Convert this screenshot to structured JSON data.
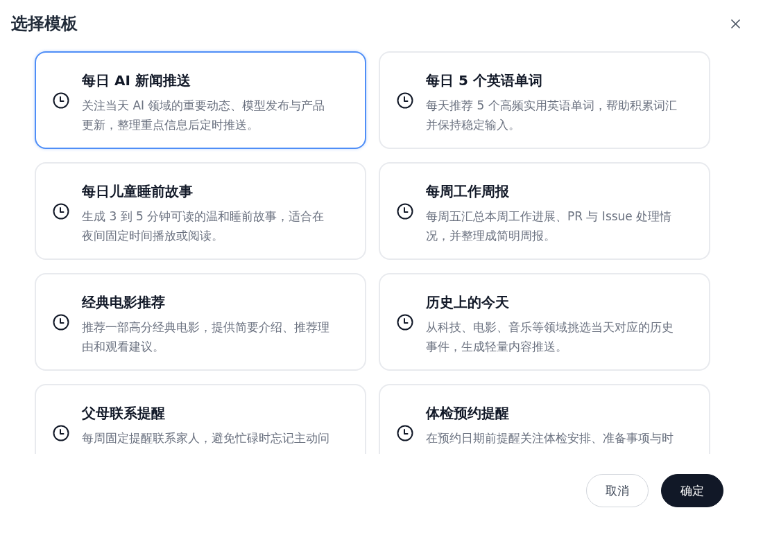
{
  "dialog": {
    "title": "选择模板"
  },
  "templates": [
    {
      "title": "每日 AI 新闻推送",
      "description": "关注当天 AI 领域的重要动态、模型发布与产品更新，整理重点信息后定时推送。",
      "selected": true
    },
    {
      "title": "每日 5 个英语单词",
      "description": "每天推荐 5 个高频实用英语单词，帮助积累词汇并保持稳定输入。",
      "selected": false
    },
    {
      "title": "每日儿童睡前故事",
      "description": "生成 3 到 5 分钟可读的温和睡前故事，适合在夜间固定时间播放或阅读。",
      "selected": false
    },
    {
      "title": "每周工作周报",
      "description": "每周五汇总本周工作进展、PR 与 Issue 处理情况，并整理成简明周报。",
      "selected": false
    },
    {
      "title": "经典电影推荐",
      "description": "推荐一部高分经典电影，提供简要介绍、推荐理由和观看建议。",
      "selected": false
    },
    {
      "title": "历史上的今天",
      "description": "从科技、电影、音乐等领域挑选当天对应的历史事件，生成轻量内容推送。",
      "selected": false
    },
    {
      "title": "父母联系提醒",
      "description": "每周固定提醒联系家人，避免忙碌时忘记主动问",
      "selected": false
    },
    {
      "title": "体检预约提醒",
      "description": "在预约日期前提醒关注体检安排、准备事项与时",
      "selected": false
    }
  ],
  "buttons": [
    {
      "label": "取消",
      "kind": "secondary"
    },
    {
      "label": "确定",
      "kind": "primary"
    }
  ]
}
